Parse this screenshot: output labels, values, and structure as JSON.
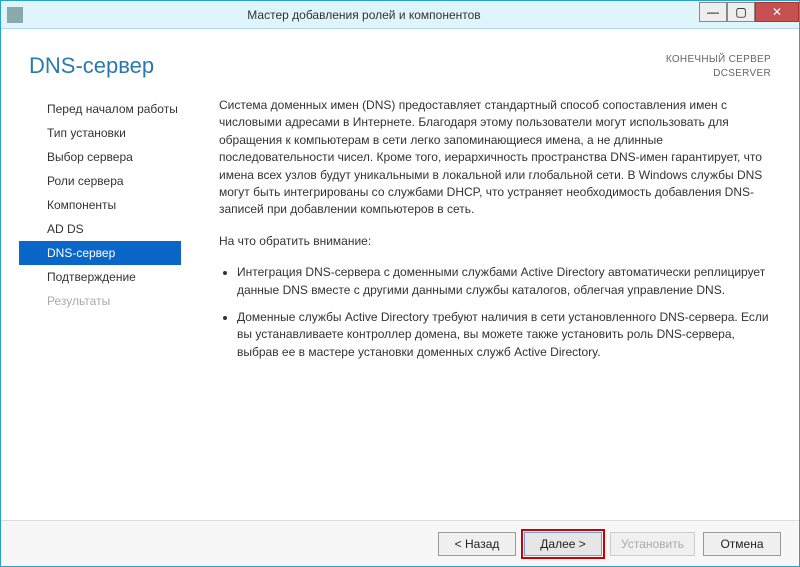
{
  "window": {
    "title": "Мастер добавления ролей и компонентов"
  },
  "header": {
    "page_title": "DNS-сервер",
    "dest_label": "КОНЕЧНЫЙ СЕРВЕР",
    "dest_value": "DCSERVER"
  },
  "nav": {
    "items": [
      {
        "label": "Перед началом работы",
        "state": "normal"
      },
      {
        "label": "Тип установки",
        "state": "normal"
      },
      {
        "label": "Выбор сервера",
        "state": "normal"
      },
      {
        "label": "Роли сервера",
        "state": "normal"
      },
      {
        "label": "Компоненты",
        "state": "normal"
      },
      {
        "label": "AD DS",
        "state": "normal"
      },
      {
        "label": "DNS-сервер",
        "state": "selected"
      },
      {
        "label": "Подтверждение",
        "state": "normal"
      },
      {
        "label": "Результаты",
        "state": "disabled"
      }
    ]
  },
  "content": {
    "description": "Система доменных имен (DNS) предоставляет стандартный способ сопоставления имен с числовыми адресами в Интернете. Благодаря этому пользователи могут использовать для обращения к компьютерам в сети легко запоминающиеся имена, а не длинные последовательности чисел. Кроме того, иерархичность пространства DNS-имен гарантирует, что имена всех узлов будут уникальными в локальной или глобальной сети. В Windows службы DNS могут быть интегрированы со службами DHCP, что устраняет необходимость добавления DNS-записей при добавлении компьютеров в сеть.",
    "notes_heading": "На что обратить внимание:",
    "notes": [
      "Интеграция DNS-сервера с доменными службами Active Directory автоматически реплицирует данные DNS вместе с другими данными службы каталогов, облегчая управление DNS.",
      "Доменные службы Active Directory требуют наличия в сети установленного DNS-сервера. Если вы устанавливаете контроллер домена, вы можете также установить роль DNS-сервера, выбрав ее в мастере установки доменных служб Active Directory."
    ]
  },
  "footer": {
    "back": "< Назад",
    "next": "Далее >",
    "install": "Установить",
    "cancel": "Отмена"
  }
}
